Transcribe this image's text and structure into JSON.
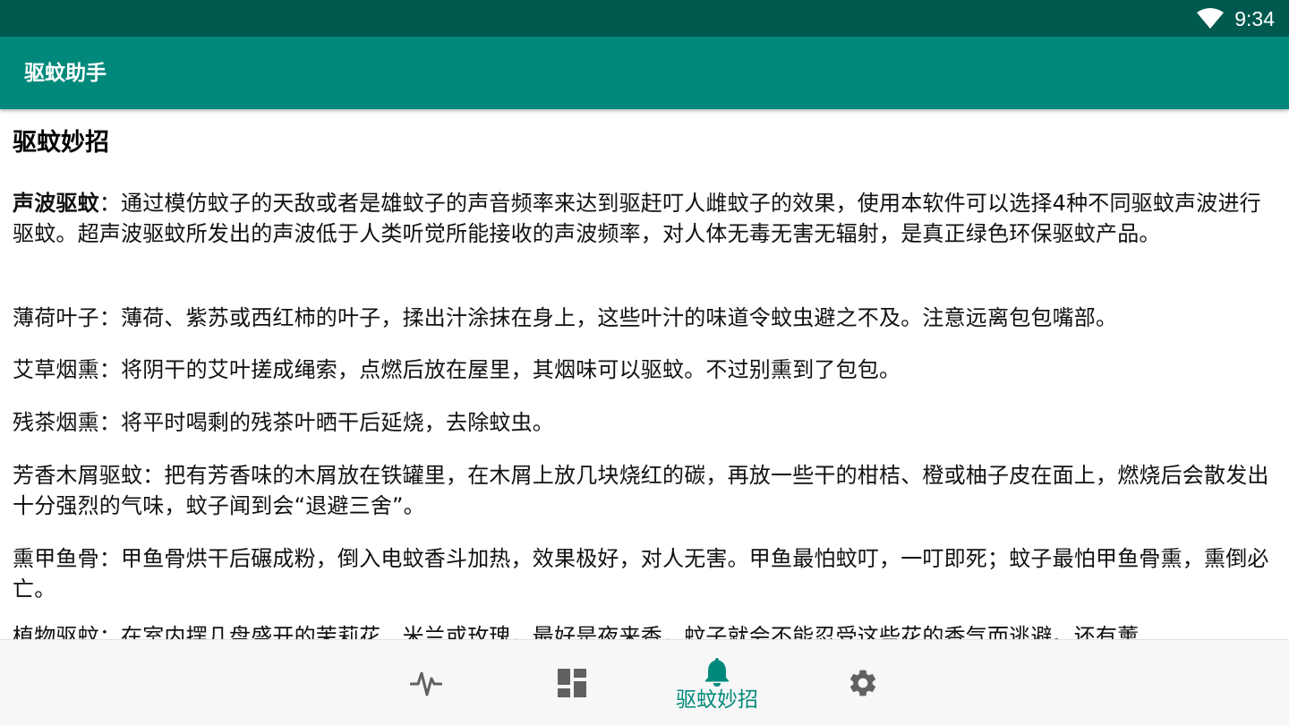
{
  "status_bar": {
    "time": "9:34",
    "icons": [
      "wifi-icon"
    ],
    "color": "#00594f"
  },
  "app_bar": {
    "title": "驱蚊助手",
    "color": "#00897b"
  },
  "content": {
    "title": "驱蚊妙招",
    "items": [
      {
        "term": "声波驱蚊",
        "text": "：通过模仿蚊子的天敌或者是雄蚊子的声音频率来达到驱赶叮人雌蚊子的效果，使用本软件可以选择4种不同驱蚊声波进行驱蚊。超声波驱蚊所发出的声波低于人类听觉所能接收的声波频率，对人体无毒无害无辐射，是真正绿色环保驱蚊产品。"
      },
      {
        "term": "薄荷叶子",
        "text": "：薄荷、紫苏或西红柿的叶子，揉出汁涂抹在身上，这些叶汁的味道令蚊虫避之不及。注意远离包包嘴部。"
      },
      {
        "term": "艾草烟熏",
        "text": "：将阴干的艾叶搓成绳索，点燃后放在屋里，其烟味可以驱蚊。不过别熏到了包包。"
      },
      {
        "term": "残茶烟熏",
        "text": "：将平时喝剩的残茶叶晒干后延烧，去除蚊虫。"
      },
      {
        "term": "芳香木屑驱蚊",
        "text": "：把有芳香味的木屑放在铁罐里，在木屑上放几块烧红的碳，再放一些干的柑桔、橙或柚子皮在面上，燃烧后会散发出十分强烈的气味，蚊子闻到会“退避三舍”。"
      },
      {
        "term": "熏甲鱼骨",
        "text": "：甲鱼骨烘干后碾成粉，倒入电蚊香斗加热，效果极好，对人无害。甲鱼最怕蚊叮，一叮即死；蚊子最怕甲鱼骨熏，熏倒必亡。"
      },
      {
        "term": "植物驱蚊",
        "text": "：在室内摆几盘盛开的茉莉花、米兰或玫瑰，最好是夜来香，蚊子就会不能忍受这些花的香气而逃避。还有薰"
      }
    ]
  },
  "bottom_nav": {
    "accent_color": "#00897b",
    "icon_color": "#616161",
    "items": [
      {
        "icon": "pulse-icon",
        "label": "",
        "active": false
      },
      {
        "icon": "dashboard-icon",
        "label": "",
        "active": false
      },
      {
        "icon": "bell-icon",
        "label": "驱蚊妙招",
        "active": true
      },
      {
        "icon": "gear-icon",
        "label": "",
        "active": false
      }
    ]
  }
}
